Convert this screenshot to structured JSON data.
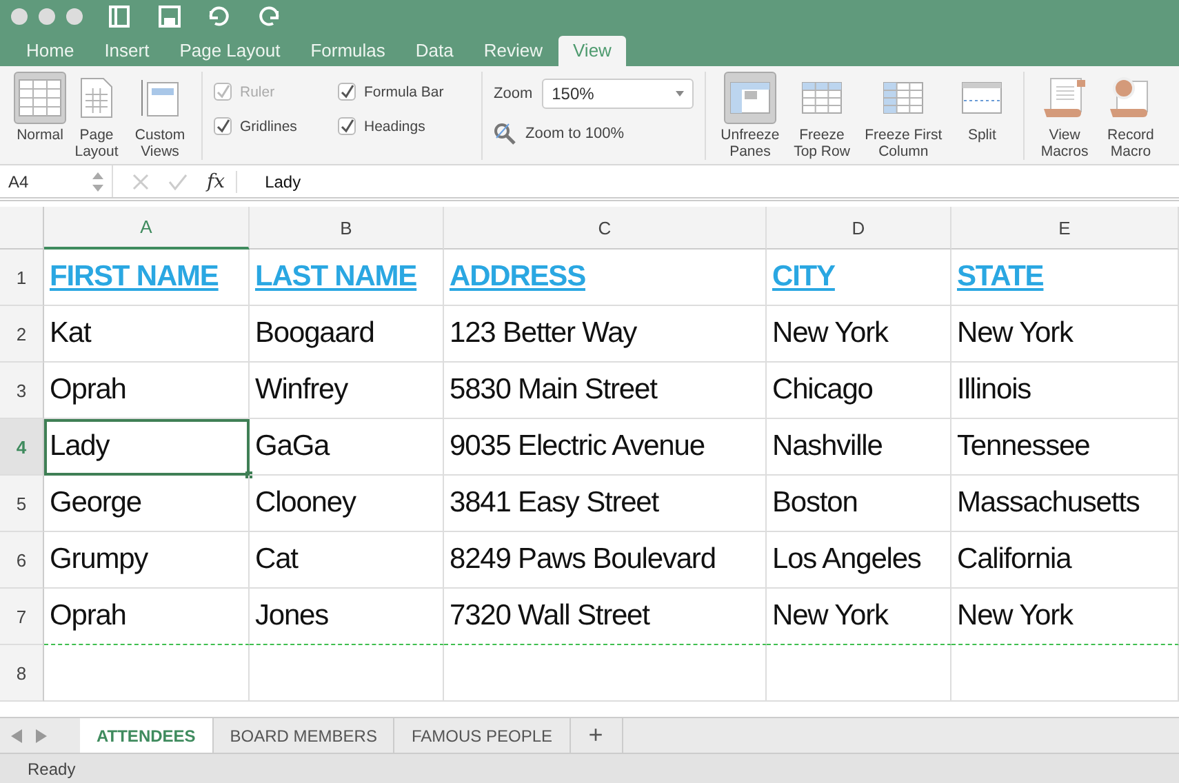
{
  "ribbon_tabs": [
    {
      "label": "Home",
      "selected": false
    },
    {
      "label": "Insert",
      "selected": false
    },
    {
      "label": "Page Layout",
      "selected": false
    },
    {
      "label": "Formulas",
      "selected": false
    },
    {
      "label": "Data",
      "selected": false
    },
    {
      "label": "Review",
      "selected": false
    },
    {
      "label": "View",
      "selected": true
    }
  ],
  "view_buttons": [
    {
      "label": "Normal",
      "kind": "normal",
      "selected": true
    },
    {
      "label": "Page Layout",
      "kind": "page",
      "selected": false
    },
    {
      "label": "Custom Views",
      "kind": "custom",
      "selected": false
    }
  ],
  "show_options": [
    {
      "label": "Ruler",
      "checked": true,
      "disabled": true
    },
    {
      "label": "Formula Bar",
      "checked": true,
      "disabled": false
    },
    {
      "label": "Gridlines",
      "checked": true,
      "disabled": false
    },
    {
      "label": "Headings",
      "checked": true,
      "disabled": false
    }
  ],
  "zoom": {
    "label": "Zoom",
    "value": "150%",
    "reset_label": "Zoom to 100%"
  },
  "freeze_buttons": [
    {
      "label": "Unfreeze Panes",
      "kind": "panes",
      "selected": true
    },
    {
      "label": "Freeze Top Row",
      "kind": "toprow",
      "selected": false
    },
    {
      "label": "Freeze First Column",
      "kind": "firstcol",
      "selected": false
    },
    {
      "label": "Split",
      "kind": "split",
      "selected": false
    }
  ],
  "macro_buttons": [
    {
      "label": "View Macros",
      "kind": "view"
    },
    {
      "label": "Record Macro",
      "kind": "record"
    }
  ],
  "formula_bar": {
    "cell_ref": "A4",
    "function_label": "fx",
    "value": "Lady"
  },
  "sheet": {
    "columns": [
      {
        "label": "A",
        "selected": true
      },
      {
        "label": "B",
        "selected": false
      },
      {
        "label": "C",
        "selected": false
      },
      {
        "label": "D",
        "selected": false
      },
      {
        "label": "E",
        "selected": false
      }
    ],
    "rows": [
      {
        "number": "1",
        "selected": false,
        "header": true,
        "page_break": false,
        "cells": [
          {
            "text": "FIRST NAME",
            "selected": false
          },
          {
            "text": "LAST NAME",
            "selected": false
          },
          {
            "text": "ADDRESS",
            "selected": false
          },
          {
            "text": "CITY",
            "selected": false
          },
          {
            "text": "STATE",
            "selected": false
          }
        ]
      },
      {
        "number": "2",
        "selected": false,
        "header": false,
        "page_break": false,
        "cells": [
          {
            "text": "Kat",
            "selected": false
          },
          {
            "text": "Boogaard",
            "selected": false
          },
          {
            "text": "123 Better Way",
            "selected": false
          },
          {
            "text": "New York",
            "selected": false
          },
          {
            "text": "New York",
            "selected": false
          }
        ]
      },
      {
        "number": "3",
        "selected": false,
        "header": false,
        "page_break": false,
        "cells": [
          {
            "text": "Oprah",
            "selected": false
          },
          {
            "text": "Winfrey",
            "selected": false
          },
          {
            "text": "5830 Main Street",
            "selected": false
          },
          {
            "text": "Chicago",
            "selected": false
          },
          {
            "text": "Illinois",
            "selected": false
          }
        ]
      },
      {
        "number": "4",
        "selected": true,
        "header": false,
        "page_break": false,
        "cells": [
          {
            "text": "Lady",
            "selected": true
          },
          {
            "text": "GaGa",
            "selected": false
          },
          {
            "text": "9035 Electric Avenue",
            "selected": false
          },
          {
            "text": "Nashville",
            "selected": false
          },
          {
            "text": "Tennessee",
            "selected": false
          }
        ]
      },
      {
        "number": "5",
        "selected": false,
        "header": false,
        "page_break": false,
        "cells": [
          {
            "text": "George",
            "selected": false
          },
          {
            "text": "Clooney",
            "selected": false
          },
          {
            "text": "3841 Easy Street",
            "selected": false
          },
          {
            "text": "Boston",
            "selected": false
          },
          {
            "text": "Massachusetts",
            "selected": false
          }
        ]
      },
      {
        "number": "6",
        "selected": false,
        "header": false,
        "page_break": false,
        "cells": [
          {
            "text": "Grumpy",
            "selected": false
          },
          {
            "text": "Cat",
            "selected": false
          },
          {
            "text": "8249 Paws Boulevard",
            "selected": false
          },
          {
            "text": "Los Angeles",
            "selected": false
          },
          {
            "text": "California",
            "selected": false
          }
        ]
      },
      {
        "number": "7",
        "selected": false,
        "header": false,
        "page_break": true,
        "cells": [
          {
            "text": "Oprah",
            "selected": false
          },
          {
            "text": "Jones",
            "selected": false
          },
          {
            "text": "7320 Wall Street",
            "selected": false
          },
          {
            "text": "New York",
            "selected": false
          },
          {
            "text": "New York",
            "selected": false
          }
        ]
      },
      {
        "number": "8",
        "selected": false,
        "page_break": false,
        "cells": []
      }
    ]
  },
  "sheet_tabs": [
    {
      "label": "ATTENDEES",
      "selected": true
    },
    {
      "label": "BOARD MEMBERS",
      "selected": false
    },
    {
      "label": "FAMOUS PEOPLE",
      "selected": false
    }
  ],
  "add_sheet": "+",
  "status_bar": {
    "text": "Ready"
  }
}
